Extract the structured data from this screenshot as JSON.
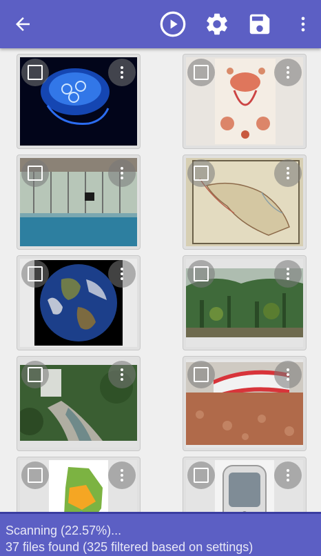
{
  "toolbar": {
    "back_icon": "arrow-back-icon",
    "play_icon": "play-circle-icon",
    "settings_icon": "gear-icon",
    "save_icon": "floppy-disk-icon",
    "more_icon": "more-vert-icon"
  },
  "colors": {
    "primary": "#5c5fc4",
    "status_border": "#3a3da0",
    "card_background": "#e0e0e0"
  },
  "grid": {
    "items": [
      {
        "name": "jellyfish"
      },
      {
        "name": "haeckel-illustration"
      },
      {
        "name": "indoor-swimming-pool"
      },
      {
        "name": "old-map-arabia"
      },
      {
        "name": "earth-globe"
      },
      {
        "name": "tropical-plants"
      },
      {
        "name": "river-gorge"
      },
      {
        "name": "lebanon-flag-landscape"
      },
      {
        "name": "lebanon-map"
      },
      {
        "name": "appliance"
      }
    ]
  },
  "status": {
    "line1": "Scanning (22.57%)...",
    "line2": "37 files found (325 filtered based on settings)",
    "progress_percent": 22.57
  }
}
